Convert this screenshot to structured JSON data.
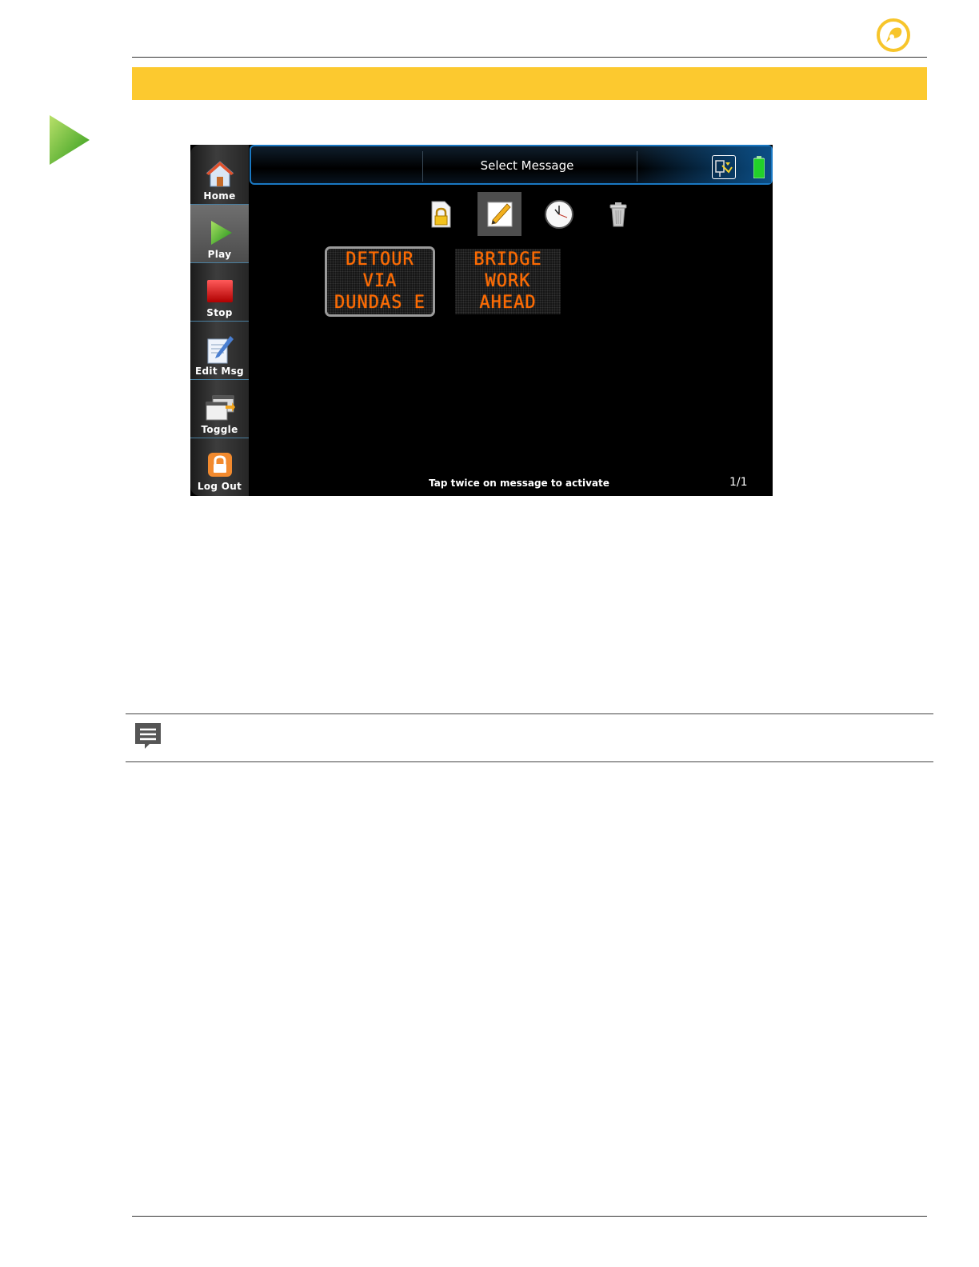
{
  "screen": {
    "title": "Select Message",
    "hint": "Tap twice on message to activate",
    "page_indicator": "1/1"
  },
  "sidebar": {
    "items": [
      {
        "label": "Home",
        "icon": "home-icon"
      },
      {
        "label": "Play",
        "icon": "play-icon",
        "active": true
      },
      {
        "label": "Stop",
        "icon": "stop-icon"
      },
      {
        "label": "Edit Msg",
        "icon": "edit-message-icon"
      },
      {
        "label": "Toggle",
        "icon": "toggle-icon"
      },
      {
        "label": "Log Out",
        "icon": "lock-icon"
      }
    ]
  },
  "toolbar": {
    "icons": [
      "locked-document-icon",
      "edit-pencil-icon",
      "clock-icon",
      "trash-icon"
    ],
    "selected": "edit-pencil-icon"
  },
  "messages": [
    {
      "lines": [
        "DETOUR",
        "VIA",
        "DUNDAS E"
      ],
      "selected": true
    },
    {
      "lines": [
        "BRIDGE",
        "WORK",
        "AHEAD"
      ],
      "selected": false
    }
  ],
  "colors": {
    "accent_yellow": "#fcc92f",
    "sign_amber": "#ff6a00",
    "title_border_blue": "#1a78c2"
  }
}
